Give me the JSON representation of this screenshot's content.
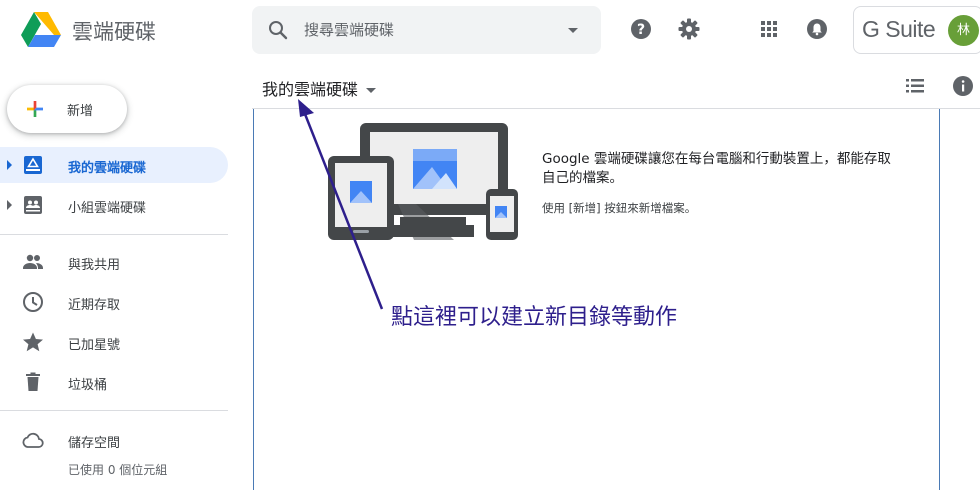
{
  "header": {
    "app_title": "雲端硬碟",
    "search_placeholder": "搜尋雲端硬碟",
    "gsuite_label": "G Suite",
    "avatar_initial": "林"
  },
  "new_button": {
    "label": "新增"
  },
  "sidebar": {
    "items": [
      {
        "label": "我的雲端硬碟",
        "icon": "my-drive-icon",
        "active": true
      },
      {
        "label": "小組雲端硬碟",
        "icon": "team-drive-icon",
        "active": false
      },
      {
        "label": "與我共用",
        "icon": "shared-people-icon",
        "active": false
      },
      {
        "label": "近期存取",
        "icon": "clock-icon",
        "active": false
      },
      {
        "label": "已加星號",
        "icon": "star-icon",
        "active": false
      },
      {
        "label": "垃圾桶",
        "icon": "trash-icon",
        "active": false
      },
      {
        "label": "儲存空間",
        "icon": "cloud-icon",
        "active": false
      }
    ],
    "storage_used": "已使用 0 個位元組"
  },
  "main": {
    "title": "我的雲端硬碟",
    "empty_state_text": "Google 雲端硬碟讓您在每台電腦和行動裝置上，都能存取自己的檔案。",
    "empty_state_hint": "使用 [新增] 按鈕來新增檔案。"
  },
  "annotation": {
    "text": "點這裡可以建立新目錄等動作"
  },
  "colors": {
    "accent": "#1967d2",
    "active_bg": "#e8f0fe",
    "icon_gray": "#5f6368",
    "annotation": "#2e1f8c",
    "avatar_bg": "#689f38"
  }
}
